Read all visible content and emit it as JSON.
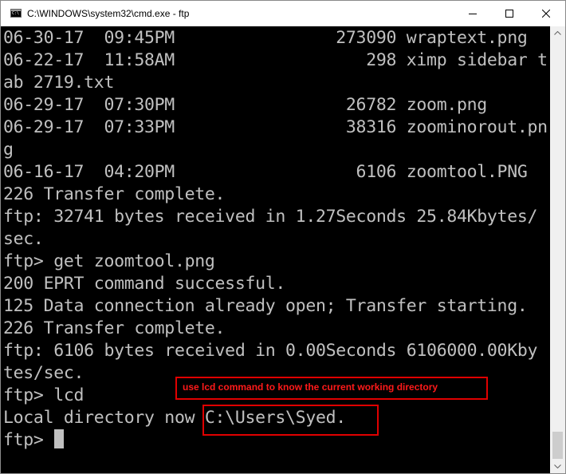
{
  "window": {
    "title": "C:\\WINDOWS\\system32\\cmd.exe - ftp",
    "icon": "cmd-icon",
    "controls": [
      "minimize-icon",
      "maximize-icon",
      "close-icon"
    ]
  },
  "console": {
    "lines": [
      "06-30-17  09:45PM                273090 wraptext.png",
      "06-22-17  11:58AM                   298 ximp sidebar t",
      "ab 2719.txt",
      "06-29-17  07:30PM                 26782 zoom.png",
      "06-29-17  07:33PM                 38316 zoominorout.pn",
      "g",
      "06-16-17  04:20PM                  6106 zoomtool.PNG",
      "226 Transfer complete.",
      "ftp: 32741 bytes received in 1.27Seconds 25.84Kbytes/",
      "sec.",
      "ftp> get zoomtool.png",
      "200 EPRT command successful.",
      "125 Data connection already open; Transfer starting.",
      "226 Transfer complete.",
      "ftp: 6106 bytes received in 0.00Seconds 6106000.00Kby",
      "tes/sec.",
      "ftp> lcd",
      "Local directory now C:\\Users\\Syed.",
      "ftp> "
    ],
    "text_color": "#c0c0c0",
    "background": "#000000"
  },
  "annotation": {
    "note": "use lcd command to know the current working directory",
    "color": "#e00000"
  }
}
